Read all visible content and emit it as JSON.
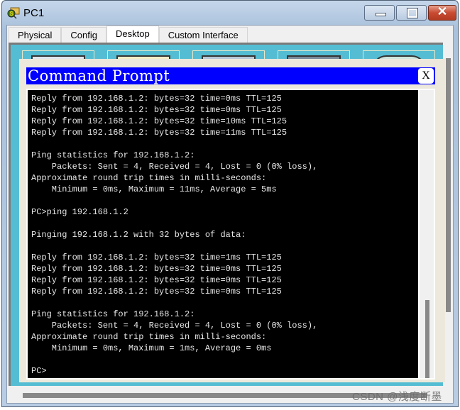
{
  "window": {
    "title": "PC1",
    "controls": {
      "minimize": "minimize",
      "maximize": "maximize",
      "close": "✕"
    }
  },
  "tabs": [
    {
      "label": "Physical",
      "active": false
    },
    {
      "label": "Config",
      "active": false
    },
    {
      "label": "Desktop",
      "active": true
    },
    {
      "label": "Custom Interface",
      "active": false
    }
  ],
  "command_prompt": {
    "title": "Command Prompt",
    "close_label": "X",
    "lines": [
      "Reply from 192.168.1.2: bytes=32 time=0ms TTL=125",
      "Reply from 192.168.1.2: bytes=32 time=0ms TTL=125",
      "Reply from 192.168.1.2: bytes=32 time=10ms TTL=125",
      "Reply from 192.168.1.2: bytes=32 time=11ms TTL=125",
      "",
      "Ping statistics for 192.168.1.2:",
      "    Packets: Sent = 4, Received = 4, Lost = 0 (0% loss),",
      "Approximate round trip times in milli-seconds:",
      "    Minimum = 0ms, Maximum = 11ms, Average = 5ms",
      "",
      "PC>ping 192.168.1.2",
      "",
      "Pinging 192.168.1.2 with 32 bytes of data:",
      "",
      "Reply from 192.168.1.2: bytes=32 time=1ms TTL=125",
      "Reply from 192.168.1.2: bytes=32 time=0ms TTL=125",
      "Reply from 192.168.1.2: bytes=32 time=0ms TTL=125",
      "Reply from 192.168.1.2: bytes=32 time=0ms TTL=125",
      "",
      "Ping statistics for 192.168.1.2:",
      "    Packets: Sent = 4, Received = 4, Lost = 0 (0% loss),",
      "Approximate round trip times in milli-seconds:",
      "    Minimum = 0ms, Maximum = 1ms, Average = 0ms",
      "",
      "PC>"
    ]
  },
  "watermark": "CSDN @浅度断墨",
  "colors": {
    "cmd_header": "#0000ff",
    "desktop_bg": "#55bdd3",
    "console_bg": "#000000",
    "close_button": "#c94b32"
  }
}
